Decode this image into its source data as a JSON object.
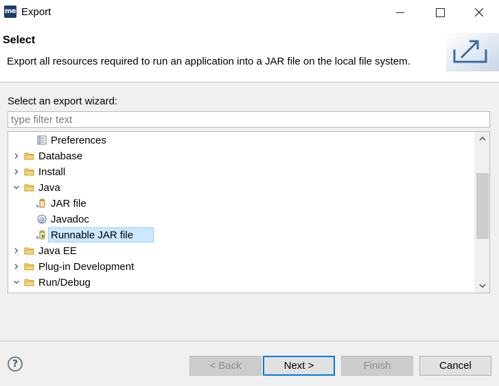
{
  "window": {
    "app_icon_text": "me",
    "title": "Export"
  },
  "header": {
    "title": "Select",
    "description": "Export all resources required to run an application into a JAR file on the local file system."
  },
  "wizard": {
    "label": "Select an export wizard:",
    "filter_placeholder": "type filter text",
    "filter_value": "",
    "tree": [
      {
        "label": "Preferences",
        "level": 1,
        "expandable": false,
        "icon": "preferences-icon"
      },
      {
        "label": "Database",
        "level": 0,
        "expandable": true,
        "expanded": false,
        "icon": "folder-icon"
      },
      {
        "label": "Install",
        "level": 0,
        "expandable": true,
        "expanded": false,
        "icon": "folder-icon"
      },
      {
        "label": "Java",
        "level": 0,
        "expandable": true,
        "expanded": true,
        "icon": "folder-icon"
      },
      {
        "label": "JAR file",
        "level": 1,
        "expandable": false,
        "icon": "jar-icon"
      },
      {
        "label": "Javadoc",
        "level": 1,
        "expandable": false,
        "icon": "javadoc-icon"
      },
      {
        "label": "Runnable JAR file",
        "level": 1,
        "expandable": false,
        "icon": "runnable-jar-icon",
        "selected": true
      },
      {
        "label": "Java EE",
        "level": 0,
        "expandable": true,
        "expanded": false,
        "icon": "folder-icon"
      },
      {
        "label": "Plug-in Development",
        "level": 0,
        "expandable": true,
        "expanded": false,
        "icon": "folder-icon"
      },
      {
        "label": "Run/Debug",
        "level": 0,
        "expandable": true,
        "expanded": true,
        "icon": "folder-icon"
      }
    ]
  },
  "footer": {
    "help_symbol": "?",
    "back_label": "< Back",
    "next_label": "Next >",
    "finish_label": "Finish",
    "cancel_label": "Cancel"
  },
  "colors": {
    "selection_bg": "#cce8ff",
    "selection_border": "#99d1ff",
    "default_button_border": "#0078d7",
    "folder": "#e8b84a"
  }
}
